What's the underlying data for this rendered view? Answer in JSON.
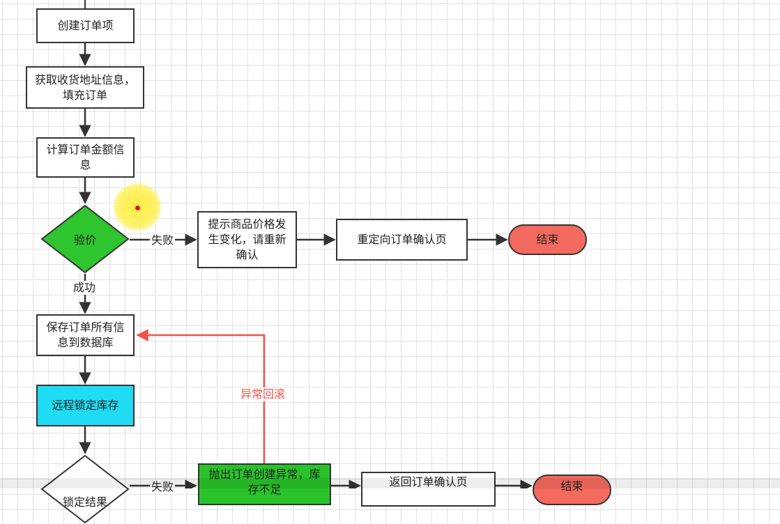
{
  "nodes": {
    "create_order_items": "创建订单项",
    "get_address": "获取收货地址信息，填充订单",
    "calc_amount": "计算订单金额信息",
    "verify_price": "验价",
    "prompt_price_change": "提示商品价格发生变化，请重新确认",
    "redirect_confirm": "重定向订单确认页",
    "end_1": "结束",
    "save_order": "保存订单所有信息到数据库",
    "lock_stock": "远程锁定库存",
    "lock_result": "锁定结果",
    "throw_exception": "抛出订单创建异常，库存不足",
    "return_confirm": "返回订单确认页",
    "end_2": "结束"
  },
  "edge_labels": {
    "verify_fail": "失败",
    "verify_success": "成功",
    "rollback": "异常回滚",
    "lock_fail": "失败"
  },
  "colors": {
    "verify_fill": "#2ec52e",
    "lock_stock_fill": "#1fdcf4",
    "end_fill": "#f46a5f",
    "throw_fill": "#29c22b",
    "rollback_line": "#f0554a",
    "line": "#333333",
    "marker": "#ffeb3b"
  }
}
